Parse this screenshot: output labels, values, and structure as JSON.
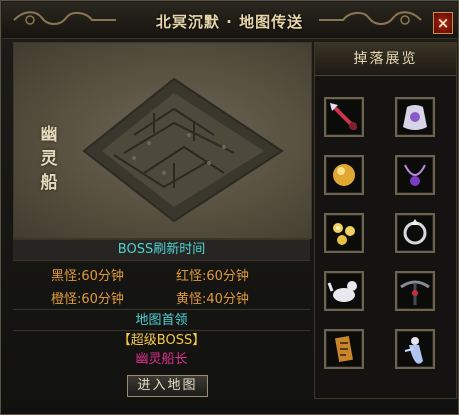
{
  "window": {
    "title": "北冥沉默 · 地图传送",
    "close_label": "×"
  },
  "map": {
    "name_chars": [
      "幽",
      "灵",
      "船"
    ]
  },
  "drops": {
    "header": "掉落展览",
    "items": [
      {
        "icon": "red-spear-icon"
      },
      {
        "icon": "white-cape-icon"
      },
      {
        "icon": "gold-orb-icon"
      },
      {
        "icon": "purple-necklace-icon"
      },
      {
        "icon": "yellow-flowers-icon"
      },
      {
        "icon": "silver-ring-icon"
      },
      {
        "icon": "white-beast-icon"
      },
      {
        "icon": "dark-crossbow-icon"
      },
      {
        "icon": "gold-scroll-icon"
      },
      {
        "icon": "blue-spirit-icon"
      }
    ]
  },
  "boss_refresh": {
    "header": "BOSS刷新时间",
    "rows": [
      {
        "label_a": "黑怪:",
        "value_a": "60分钟",
        "label_b": "红怪:",
        "value_b": "60分钟"
      },
      {
        "label_a": "橙怪:",
        "value_a": "60分钟",
        "label_b": "黄怪:",
        "value_b": "40分钟"
      }
    ]
  },
  "first_kill": {
    "header": "地图首领",
    "boss_tag": "【超级BOSS】",
    "boss_name": "幽灵船长"
  },
  "enter_button": "进入地图",
  "colors": {
    "cyan": "#4fd3d5",
    "orange": "#e09a3a",
    "gold": "#f5c84a",
    "pink": "#e0308e"
  }
}
